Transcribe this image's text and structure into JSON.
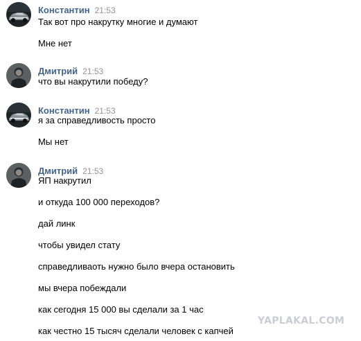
{
  "messages": [
    {
      "author": "Константин",
      "time": "21:53",
      "avatar_icon": "car-avatar-icon",
      "lines": [
        "Так вот про накрутку многие и думают",
        "Мне нет"
      ]
    },
    {
      "author": "Дмитрий",
      "time": "21:53",
      "avatar_icon": "person-avatar-icon",
      "lines": [
        "что вы накрутили победу?"
      ]
    },
    {
      "author": "Константин",
      "time": "21:53",
      "avatar_icon": "car-avatar-icon",
      "lines": [
        "я за справедливость просто",
        "Мы нет"
      ]
    },
    {
      "author": "Дмитрий",
      "time": "21:53",
      "avatar_icon": "person-avatar-icon",
      "lines": [
        "ЯП накрутил",
        "и откуда 100 000 переходов?",
        "дай линк",
        "чтобы увидел стату",
        "справедливаоть нужно было вчера остановить",
        "мы вчера побеждали",
        "как сегодня 15 000 вы сделали за 1 час",
        "как честно 15 тысяч сделали человек с капчей"
      ]
    }
  ],
  "watermark": "YAPLAKAL.COM",
  "colors": {
    "author": "#42648b",
    "time": "#939393",
    "text": "#000000",
    "watermark": "#c9ced6"
  }
}
